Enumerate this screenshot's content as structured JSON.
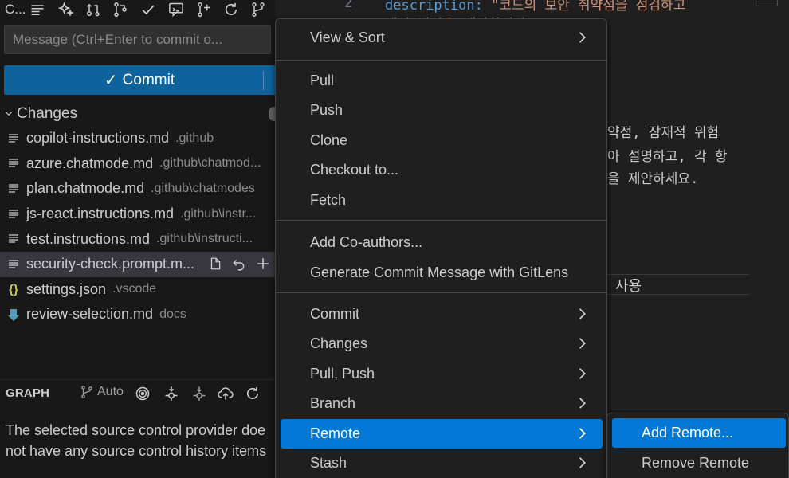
{
  "toolbar": {
    "title": "C...",
    "icons": [
      "list-icon",
      "sparkle-icon",
      "pull-request-create-icon",
      "branch-compare-icon",
      "check-icon",
      "comment-discussion-icon",
      "branch-add-icon",
      "refresh-icon",
      "graph-icon",
      "more-icon"
    ],
    "more_label": "···"
  },
  "commit_message": {
    "placeholder": "Message (Ctrl+Enter to commit o..."
  },
  "commit_button": {
    "check": "✓",
    "label": "Commit"
  },
  "changes": {
    "label": "Changes",
    "files": [
      {
        "icon": "lines",
        "name": "copilot-instructions.md",
        "dir": ".github"
      },
      {
        "icon": "lines",
        "name": "azure.chatmode.md",
        "dir": ".github\\chatmod..."
      },
      {
        "icon": "lines",
        "name": "plan.chatmode.md",
        "dir": ".github\\chatmodes"
      },
      {
        "icon": "lines",
        "name": "js-react.instructions.md",
        "dir": ".github\\instr..."
      },
      {
        "icon": "lines",
        "name": "test.instructions.md",
        "dir": ".github\\instructi..."
      },
      {
        "icon": "lines",
        "name": "security-check.prompt.m...",
        "dir": "",
        "selected": true
      },
      {
        "icon": "json",
        "name": "settings.json",
        "dir": ".vscode"
      },
      {
        "icon": "md",
        "name": "review-selection.md",
        "dir": "docs"
      }
    ]
  },
  "graph": {
    "title": "GRAPH",
    "auto_label": "Auto",
    "message_line1": "The selected source control provider doe",
    "message_line2": "not have any source control history items"
  },
  "editor": {
    "line_number": "2",
    "desc_key": "description:",
    "desc_value": "\"코드의 보안 취약점을 점검하고",
    "desc_value2": "개선 방안을 제안합니다.\"",
    "body_line1": "약점, 잠재적 위험",
    "body_line2": "아 설명하고, 각 항",
    "body_line3": "을 제안하세요.",
    "word": "사용"
  },
  "menu": {
    "items": [
      {
        "label": "View & Sort",
        "submenu": true
      },
      {
        "label": "Pull",
        "submenu": false
      },
      {
        "label": "Push",
        "submenu": false
      },
      {
        "label": "Clone",
        "submenu": false
      },
      {
        "label": "Checkout to...",
        "submenu": false
      },
      {
        "label": "Fetch",
        "submenu": false
      },
      {
        "label": "Add Co-authors...",
        "submenu": false
      },
      {
        "label": "Generate Commit Message with GitLens",
        "submenu": false
      },
      {
        "label": "Commit",
        "submenu": true
      },
      {
        "label": "Changes",
        "submenu": true
      },
      {
        "label": "Pull, Push",
        "submenu": true
      },
      {
        "label": "Branch",
        "submenu": true
      },
      {
        "label": "Remote",
        "submenu": true,
        "active": true
      },
      {
        "label": "Stash",
        "submenu": true
      }
    ]
  },
  "submenu": {
    "items": [
      {
        "label": "Add Remote...",
        "active": true
      },
      {
        "label": "Remove Remote",
        "active": false
      }
    ]
  },
  "colors": {
    "accent": "#0078d4",
    "commit_button": "#0e639c",
    "panel_bg": "#181818",
    "menu_bg": "#1f1f1f"
  }
}
